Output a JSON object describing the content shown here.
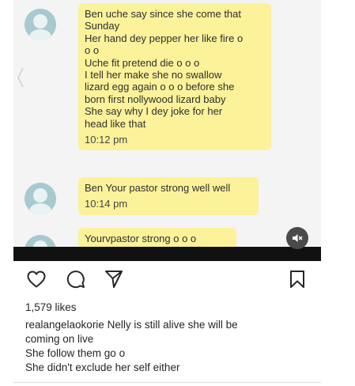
{
  "screenshot": {
    "messages": [
      {
        "lines": [
          "Ben uche say since she come that",
          "Sunday",
          "Her hand dey pepper her like fire o",
          "o o",
          "Uche fit pretend die o o o",
          "I tell her make she no swallow",
          "lizard egg again o o o before she",
          "born first nollywood lizard baby",
          "She say why I dey joke for her",
          "head like that"
        ],
        "time": "10:12 pm"
      },
      {
        "lines": [
          "Ben Your pastor strong well well"
        ],
        "time": "10:14 pm"
      },
      {
        "lines": [
          "Yourvpastor strong o o o"
        ],
        "time": ""
      }
    ]
  },
  "post": {
    "likes": "1,579 likes",
    "caption_lines": [
      "realangelaokorie Nelly is still alive she will be",
      "coming on live",
      "She follow them go o",
      "She didn't exclude her self either"
    ]
  },
  "icons": {
    "like": "heart-icon",
    "comment": "comment-icon",
    "share": "send-icon",
    "save": "bookmark-icon",
    "mute": "speaker-mute-icon",
    "avatar": "default-avatar-icon"
  },
  "colors": {
    "bubble": "#fbf29a",
    "avatar": "#a7c9cf",
    "text": "#262626"
  }
}
